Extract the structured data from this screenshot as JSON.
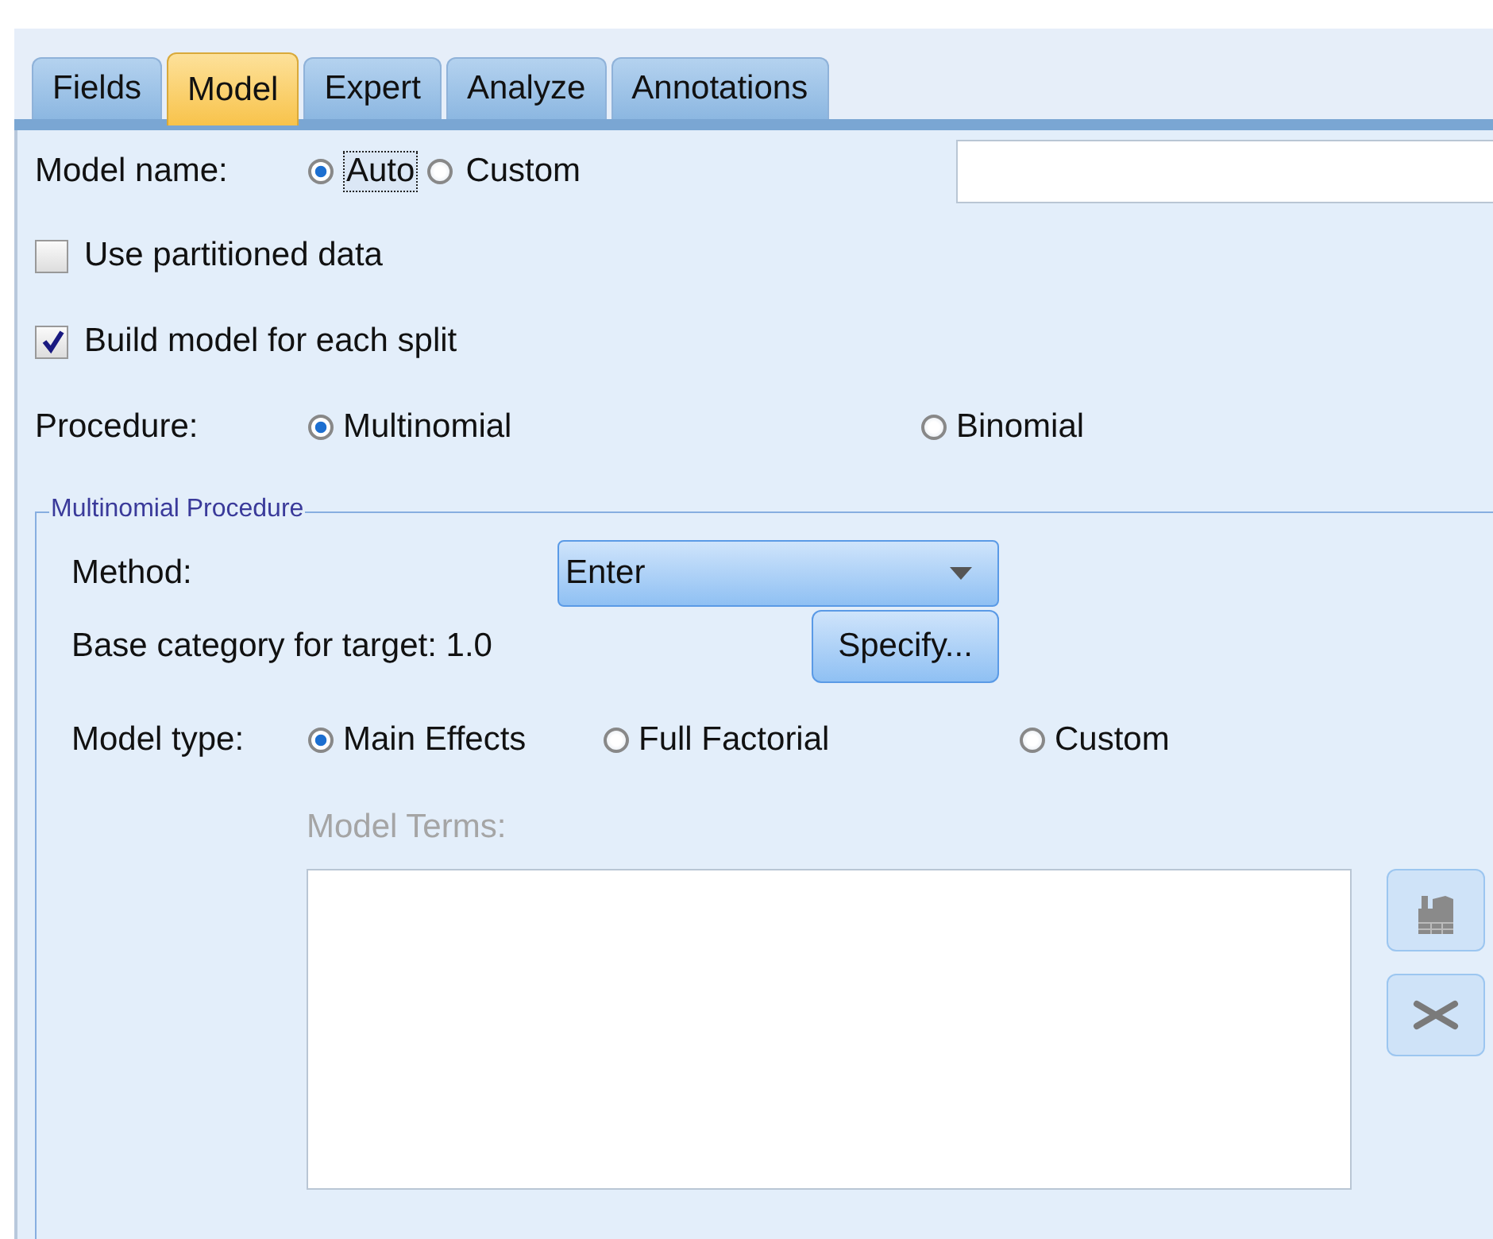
{
  "tabs": [
    {
      "label": "Fields",
      "selected": false
    },
    {
      "label": "Model",
      "selected": true
    },
    {
      "label": "Expert",
      "selected": false
    },
    {
      "label": "Analyze",
      "selected": false
    },
    {
      "label": "Annotations",
      "selected": false
    }
  ],
  "model_name": {
    "label": "Model name:",
    "options": [
      {
        "label": "Auto",
        "selected": true,
        "focused": true
      },
      {
        "label": "Custom",
        "selected": false,
        "focused": false
      }
    ]
  },
  "checkboxes": [
    {
      "label": "Use partitioned data",
      "checked": false
    },
    {
      "label": "Build model for each split",
      "checked": true
    }
  ],
  "procedure": {
    "label": "Procedure:",
    "options": [
      {
        "label": "Multinomial",
        "selected": true
      },
      {
        "label": "Binomial",
        "selected": false
      }
    ]
  },
  "group": {
    "title": "Multinomial Procedure",
    "method_label": "Method:",
    "method_value": "Enter",
    "base_label": "Base category for target: 1.0",
    "specify_button": "Specify...",
    "model_type": {
      "label": "Model type:",
      "options": [
        {
          "label": "Main Effects",
          "selected": true
        },
        {
          "label": "Full Factorial",
          "selected": false
        },
        {
          "label": "Custom",
          "selected": false
        }
      ]
    },
    "terms_label": "Model Terms:",
    "terms_disabled": true
  }
}
